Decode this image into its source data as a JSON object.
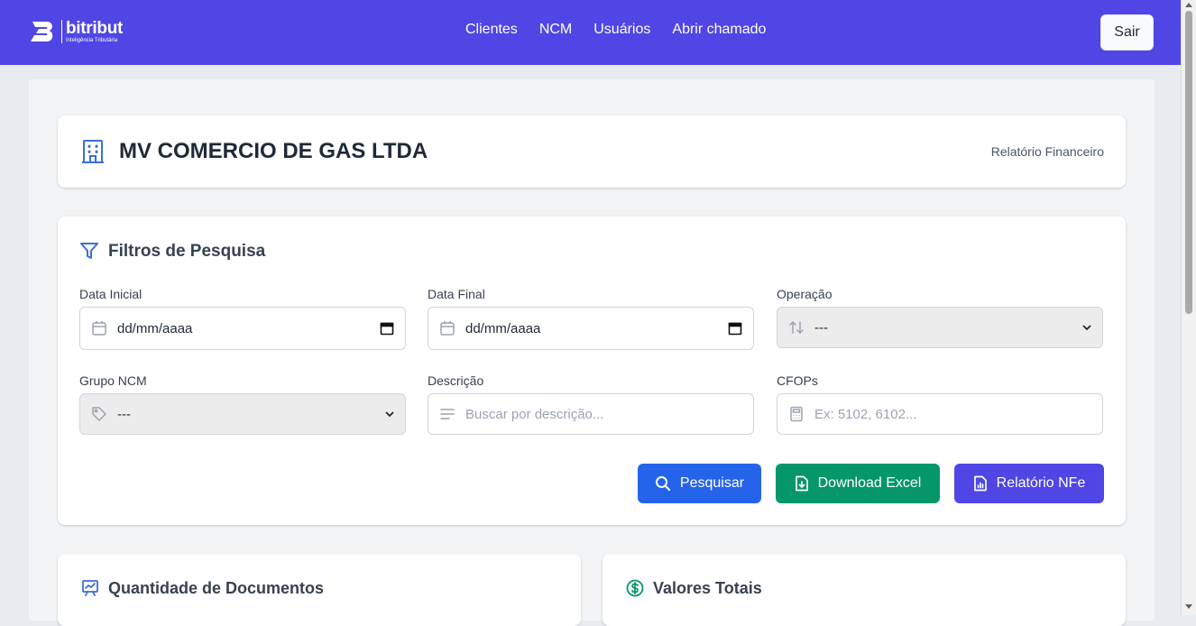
{
  "brand": {
    "name": "bitribut",
    "tagline": "Inteligência Tributária"
  },
  "nav": {
    "links": [
      "Clientes",
      "NCM",
      "Usuários",
      "Abrir chamado"
    ],
    "logout": "Sair"
  },
  "company": {
    "name": "MV COMERCIO DE GAS LTDA",
    "report_label": "Relatório Financeiro"
  },
  "filters": {
    "title": "Filtros de Pesquisa",
    "data_inicial": {
      "label": "Data Inicial",
      "value": "dd/mm/aaaa"
    },
    "data_final": {
      "label": "Data Final",
      "value": "dd/mm/aaaa"
    },
    "operacao": {
      "label": "Operação",
      "value": "---"
    },
    "grupo_ncm": {
      "label": "Grupo NCM",
      "value": "---"
    },
    "descricao": {
      "label": "Descrição",
      "placeholder": "Buscar por descrição..."
    },
    "cfops": {
      "label": "CFOPs",
      "placeholder": "Ex: 5102, 6102..."
    }
  },
  "actions": {
    "search": "Pesquisar",
    "excel": "Download Excel",
    "nfe": "Relatório NFe"
  },
  "stats": {
    "documents_title": "Quantidade de Documentos",
    "totals_title": "Valores Totais"
  },
  "colors": {
    "primary": "#4f46e5",
    "search": "#2563eb",
    "excel": "#059669",
    "accent_blue": "#3b6fd6",
    "accent_green": "#059669"
  }
}
